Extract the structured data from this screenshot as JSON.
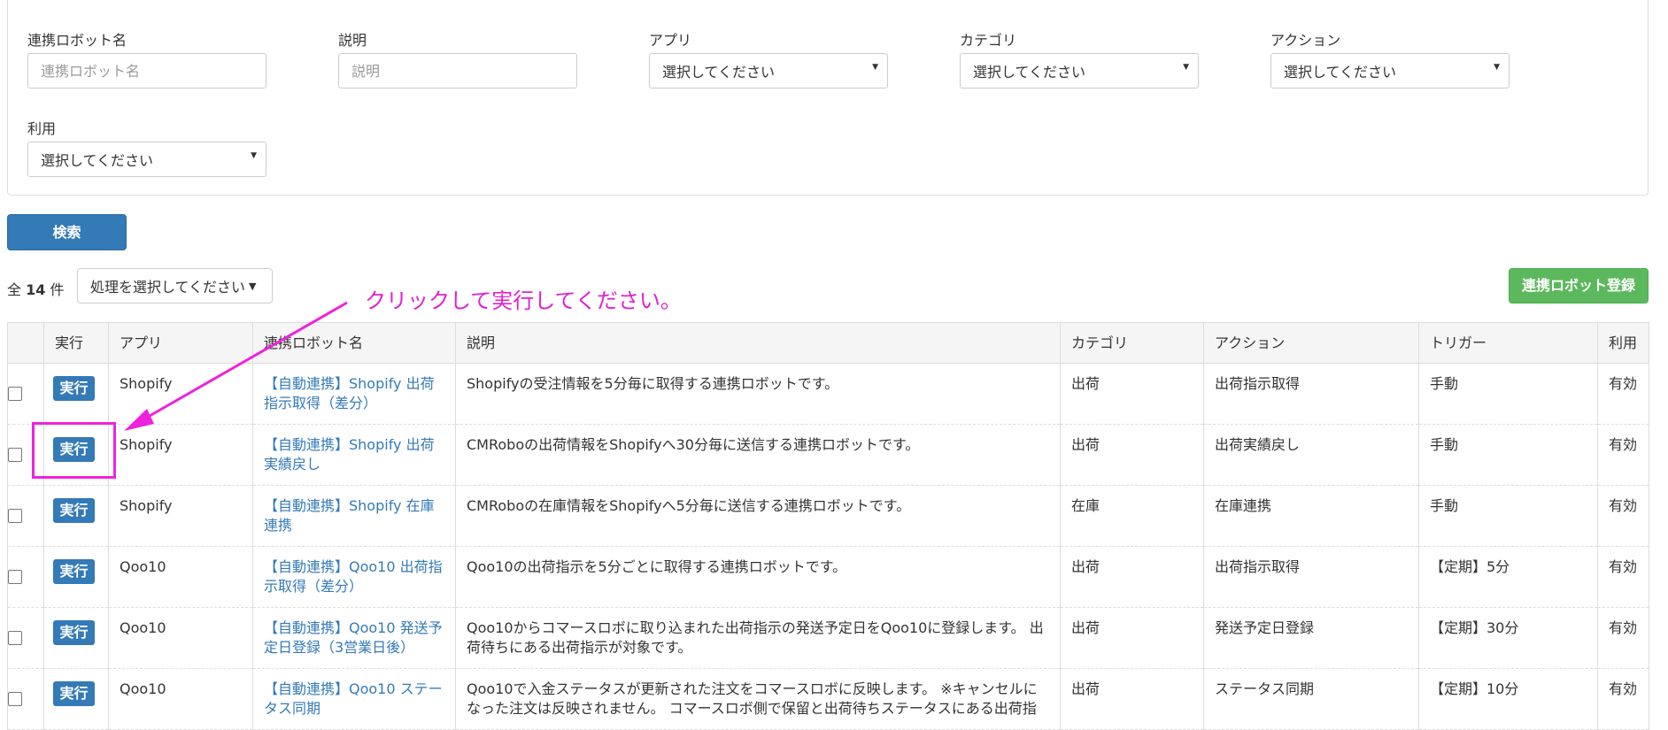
{
  "filters": {
    "robot_name": {
      "label": "連携ロボット名",
      "placeholder": "連携ロボット名"
    },
    "description": {
      "label": "説明",
      "placeholder": "説明"
    },
    "app": {
      "label": "アプリ",
      "value": "選択してください"
    },
    "category": {
      "label": "カテゴリ",
      "value": "選択してください"
    },
    "action": {
      "label": "アクション",
      "value": "選択してください"
    },
    "usage": {
      "label": "利用",
      "value": "選択してください"
    }
  },
  "search_label": "検索",
  "count": {
    "prefix": "全",
    "number": "14",
    "suffix": "件"
  },
  "bulk_action_label": "処理を選択してください",
  "register_label": "連携ロボット登録",
  "annotation": "クリックして実行してください。",
  "accent_colors": {
    "primary": "#337ab7",
    "success": "#5cb85c",
    "annotation": "#ee22dd"
  },
  "table": {
    "headers": [
      "",
      "実行",
      "アプリ",
      "連携ロボット名",
      "説明",
      "カテゴリ",
      "アクション",
      "トリガー",
      "利用"
    ],
    "run_label": "実行",
    "rows": [
      {
        "app": "Shopify",
        "name": "【自動連携】Shopify 出荷指示取得（差分）",
        "desc": "Shopifyの受注情報を5分毎に取得する連携ロボットです。",
        "category": "出荷",
        "action": "出荷指示取得",
        "trigger": "手動",
        "usage": "有効"
      },
      {
        "app": "Shopify",
        "name": "【自動連携】Shopify 出荷実績戻し",
        "desc": "CMRoboの出荷情報をShopifyへ30分毎に送信する連携ロボットです。",
        "category": "出荷",
        "action": "出荷実績戻し",
        "trigger": "手動",
        "usage": "有効"
      },
      {
        "app": "Shopify",
        "name": "【自動連携】Shopify 在庫連携",
        "desc": "CMRoboの在庫情報をShopifyへ5分毎に送信する連携ロボットです。",
        "category": "在庫",
        "action": "在庫連携",
        "trigger": "手動",
        "usage": "有効"
      },
      {
        "app": "Qoo10",
        "name": "【自動連携】Qoo10 出荷指示取得（差分）",
        "desc": "Qoo10の出荷指示を5分ごとに取得する連携ロボットです。",
        "category": "出荷",
        "action": "出荷指示取得",
        "trigger": "【定期】5分",
        "usage": "有効"
      },
      {
        "app": "Qoo10",
        "name": "【自動連携】Qoo10 発送予定日登録（3営業日後）",
        "desc": "Qoo10からコマースロボに取り込まれた出荷指示の発送予定日をQoo10に登録します。 出荷待ちにある出荷指示が対象です。",
        "category": "出荷",
        "action": "発送予定日登録",
        "trigger": "【定期】30分",
        "usage": "有効"
      },
      {
        "app": "Qoo10",
        "name": "【自動連携】Qoo10 ステータス同期",
        "desc": "Qoo10で入金ステータスが更新された注文をコマースロボに反映します。 ※キャンセルになった注文は反映されません。 コマースロボ側で保留と出荷待ちステータスにある出荷指",
        "category": "出荷",
        "action": "ステータス同期",
        "trigger": "【定期】10分",
        "usage": "有効"
      }
    ]
  }
}
